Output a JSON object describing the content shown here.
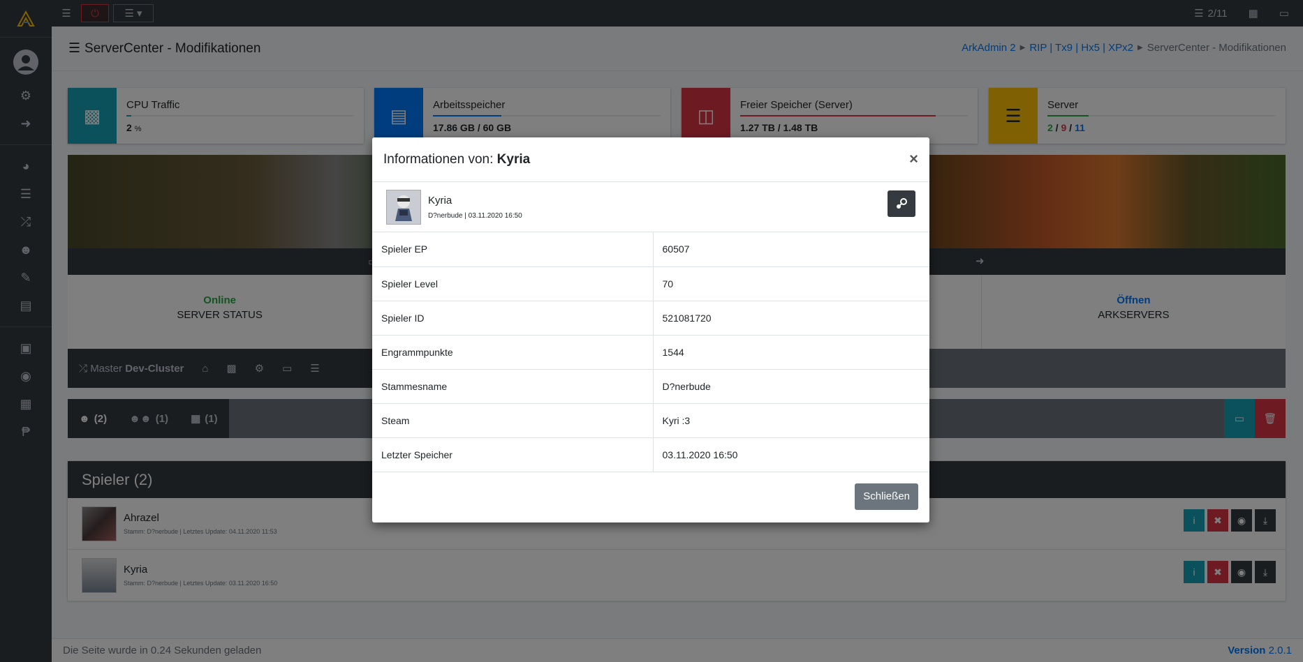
{
  "topbar": {
    "server_count": "2/11"
  },
  "header": {
    "title": "ServerCenter - Modifikationen",
    "breadcrumb": [
      "ArkAdmin 2",
      "RIP | Tx9 | Hx5 | XPx2",
      "ServerCenter - Modifikationen"
    ]
  },
  "info_boxes": [
    {
      "label": "CPU Traffic",
      "value": "2",
      "unit": "%",
      "color": "#17a2b8",
      "icon": "cpu-icon",
      "fill": 0.02,
      "bar_color": "#17a2b8"
    },
    {
      "label": "Arbeitsspeicher",
      "value": "17.86 GB / 60 GB",
      "color": "#007bff",
      "icon": "memory-icon",
      "fill": 0.3,
      "bar_color": "#007bff"
    },
    {
      "label": "Freier Speicher (Server)",
      "value": "1.27 TB / 1.48 TB",
      "color": "#dc3545",
      "icon": "hdd-icon",
      "fill": 0.86,
      "bar_color": "#dc3545"
    },
    {
      "label": "Server",
      "value_green": "2",
      "value_red": "9",
      "value_blue": "11",
      "color": "#ffc107",
      "icon": "server-icon",
      "fill": 0.18,
      "bar_color": "#28a745"
    }
  ],
  "status": {
    "server_status_value": "Online",
    "server_status_label": "SERVER STATUS",
    "arkservers_value": "Öffnen",
    "arkservers_label": "ARKSERVERS"
  },
  "cluster": {
    "prefix": "Master",
    "name": "Dev-Cluster"
  },
  "tabs": [
    {
      "label": "(2)",
      "icon": "user-icon"
    },
    {
      "label": "(1)",
      "icon": "users-icon"
    },
    {
      "label": "(1)",
      "icon": "map-icon"
    }
  ],
  "players": {
    "header": "Spieler (2)",
    "rows": [
      {
        "name": "Ahrazel",
        "sub": "Stamm: D?nerbude | Letztes Update: 04.11.2020 11:53"
      },
      {
        "name": "Kyria",
        "sub": "Stamm: D?nerbude | Letztes Update: 03.11.2020 16:50"
      }
    ]
  },
  "footer": {
    "load_text": "Die Seite wurde in 0.24 Sekunden geladen",
    "version_label": "Version",
    "version_number": "2.0.1"
  },
  "modal": {
    "title_prefix": "Informationen von:",
    "title_name": "Kyria",
    "profile_name": "Kyria",
    "profile_sub": "D?nerbude | 03.11.2020 16:50",
    "rows": [
      {
        "label": "Spieler EP",
        "value": "60507"
      },
      {
        "label": "Spieler Level",
        "value": "70"
      },
      {
        "label": "Spieler ID",
        "value": "521081720"
      },
      {
        "label": "Engrammpunkte",
        "value": "1544"
      },
      {
        "label": "Stammesname",
        "value": "D?nerbude"
      },
      {
        "label": "Steam",
        "value": "Kyri :3"
      },
      {
        "label": "Letzter Speicher",
        "value": "03.11.2020 16:50"
      }
    ],
    "close_label": "Schließen",
    "close_x": "×"
  }
}
